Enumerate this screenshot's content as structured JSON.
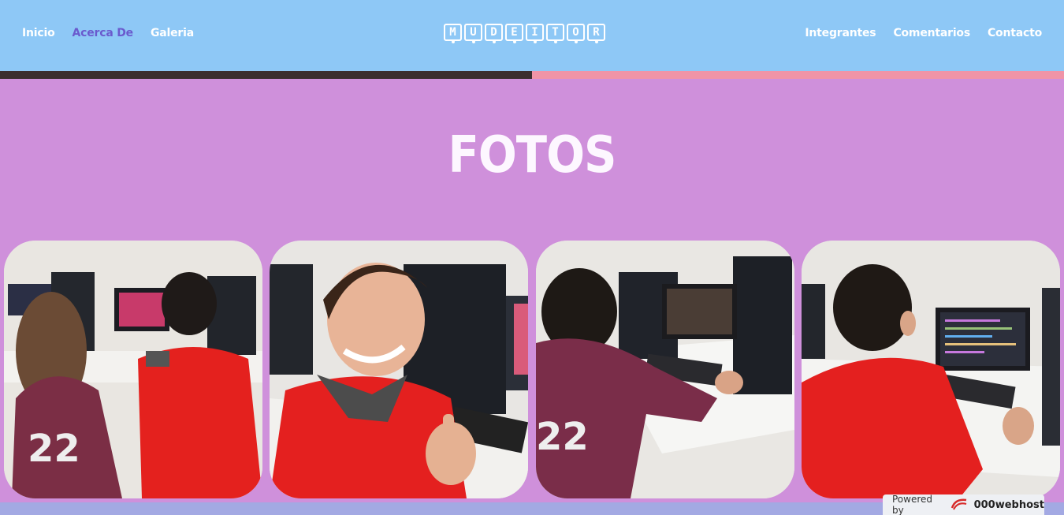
{
  "nav": {
    "left": [
      {
        "label": "Inicio"
      },
      {
        "label": "Acerca De"
      },
      {
        "label": "Galeria"
      }
    ],
    "right": [
      {
        "label": "Integrantes"
      },
      {
        "label": "Comentarios"
      },
      {
        "label": "Contacto"
      }
    ],
    "active": "Acerca De"
  },
  "logo": {
    "letters": [
      "M",
      "U",
      "D",
      "E",
      "I",
      "T",
      "O",
      "R"
    ]
  },
  "gallery": {
    "title": "FOTOS",
    "photos": [
      {
        "subject": "two students at computer"
      },
      {
        "subject": "smiling student thumbs up"
      },
      {
        "subject": "student typing at computer"
      },
      {
        "subject": "student coding at monitor"
      }
    ]
  },
  "footer_badge": {
    "powered_by": "Powered by",
    "brand": "000webhost"
  },
  "colors": {
    "header": "#8ec8f6",
    "section": "#cf90db",
    "active_link": "#6a5acd",
    "strip_left": "#3b2e2f",
    "strip_right": "#f094a7",
    "bottom": "#a3a9e3"
  }
}
